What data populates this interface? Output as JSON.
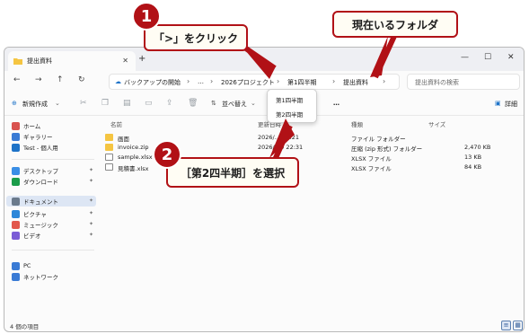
{
  "window": {
    "tab_title": "提出資料",
    "new_tab": "+",
    "controls": [
      "—",
      "☐",
      "✕"
    ]
  },
  "address": {
    "home_crumb": "バックアップの開始",
    "ellipsis": "…",
    "crumbs": [
      "2026プロジェクト",
      "第1四半期",
      "提出資料"
    ],
    "search_placeholder": "提出資料の検索"
  },
  "toolbar": {
    "new_label": "新規作成",
    "sort_label": "並べ替え",
    "view_label": "表示",
    "more_label": "…",
    "details_label": "詳細"
  },
  "sidebar": {
    "items": [
      {
        "label": "ホーム",
        "icon": "home-icon",
        "color": "#d9534f"
      },
      {
        "label": "ギャラリー",
        "icon": "gallery-icon",
        "color": "#3a7bd5"
      },
      {
        "label": "Test - 個人用",
        "icon": "cloud-icon",
        "color": "#1e73c8"
      },
      {
        "label": "デスクトップ",
        "icon": "desktop-icon",
        "color": "#3a8ee6"
      },
      {
        "label": "ダウンロード",
        "icon": "download-icon",
        "color": "#1a9c4a"
      },
      {
        "label": "ドキュメント",
        "icon": "document-icon",
        "color": "#6a7a8c"
      },
      {
        "label": "ピクチャ",
        "icon": "picture-icon",
        "color": "#2c87d9"
      },
      {
        "label": "ミュージック",
        "icon": "music-icon",
        "color": "#e2574c"
      },
      {
        "label": "ビデオ",
        "icon": "video-icon",
        "color": "#7b5cd6"
      },
      {
        "label": "PC",
        "icon": "pc-icon",
        "color": "#3a7bd5"
      },
      {
        "label": "ネットワーク",
        "icon": "network-icon",
        "color": "#3a7bd5"
      }
    ]
  },
  "list": {
    "headers": [
      "名前",
      "更新日時",
      "種類",
      "サイズ"
    ],
    "rows": [
      {
        "name": "画面",
        "date": "2026/…1 8:21",
        "type": "ファイル フォルダー",
        "size": "",
        "icon": "folder-icon",
        "color": "#f5c542"
      },
      {
        "name": "invoice.zip",
        "date": "2026/…9 22:31",
        "type": "圧縮 (zip 形式) フォルダー",
        "size": "2,470 KB",
        "icon": "zip-folder-icon",
        "color": "#f5c542"
      },
      {
        "name": "sample.xlsx",
        "date": "",
        "type": "XLSX ファイル",
        "size": "13 KB",
        "icon": "file-icon",
        "color": "#ffffff"
      },
      {
        "name": "見積書.xlsx",
        "date": "",
        "type": "XLSX ファイル",
        "size": "84 KB",
        "icon": "file-icon",
        "color": "#ffffff"
      }
    ]
  },
  "dropdown": {
    "items": [
      "第1四半期",
      "第2四半期"
    ]
  },
  "status": {
    "count": "4 個の項目"
  },
  "annotations": {
    "step1_number": "1",
    "step1_text": "「>」をクリック",
    "current_folder_text": "現在いるフォルダ",
    "step2_number": "2",
    "step2_text": "［第2四半期］を選択",
    "accent": "#b11116"
  }
}
